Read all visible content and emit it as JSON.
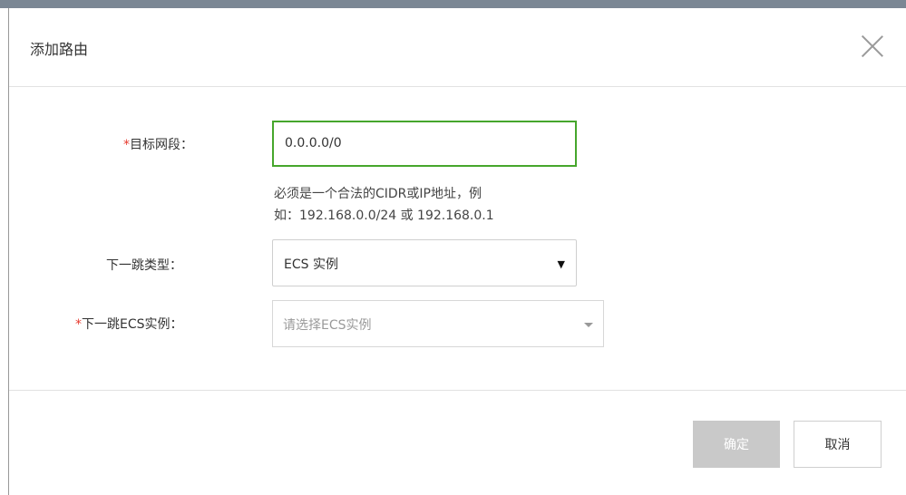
{
  "dialog": {
    "title": "添加路由",
    "close_icon": "close-icon"
  },
  "form": {
    "dest_label_prefix": "*",
    "dest_label": "目标网段：",
    "dest_value": "0.0.0.0/0",
    "help_line1": "必须是一个合法的CIDR或IP地址，例",
    "help_line2": "如：192.168.0.0/24 或 192.168.0.1",
    "nexthop_type_label": "下一跳类型：",
    "nexthop_type_value": "ECS 实例",
    "nexthop_type_arrow": "▼",
    "ecs_label_prefix": "*",
    "ecs_label": "下一跳ECS实例：",
    "ecs_placeholder": "请选择ECS实例"
  },
  "footer": {
    "ok_label": "确定",
    "cancel_label": "取消"
  },
  "colors": {
    "required": "#e63a2e",
    "focus_border": "#46a62c",
    "disabled_button": "#c9c9c9"
  }
}
